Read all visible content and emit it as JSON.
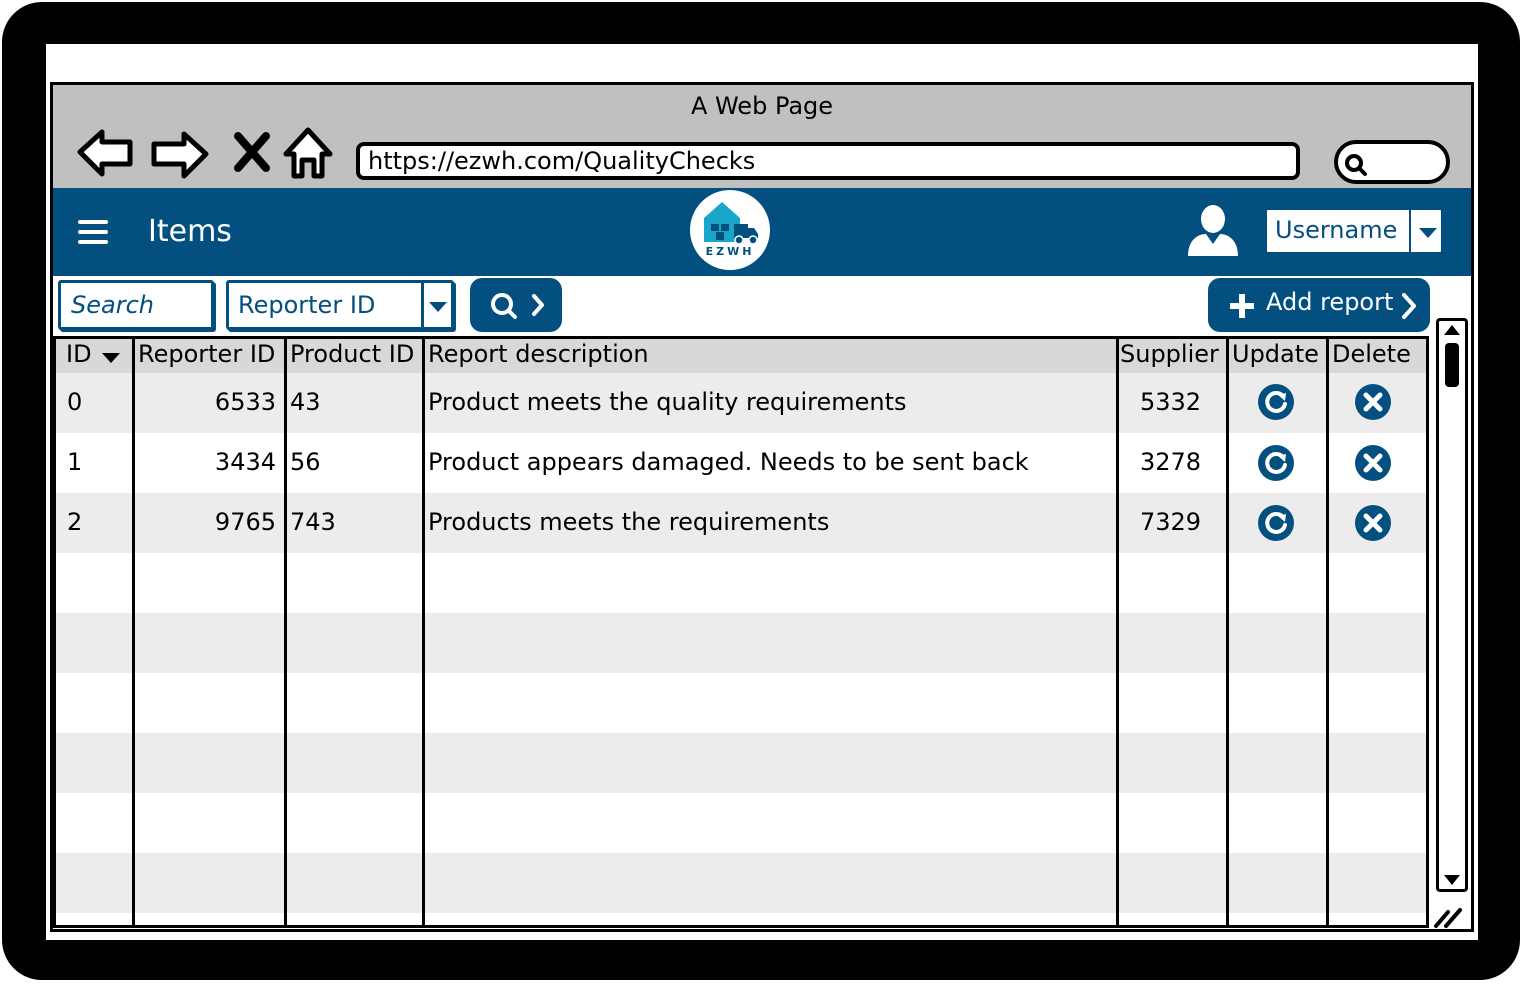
{
  "window": {
    "title": "A Web Page"
  },
  "browser": {
    "url": "https://ezwh.com/QualityChecks",
    "nav_icons": [
      "back-arrow-icon",
      "forward-arrow-icon",
      "close-x-icon",
      "home-icon"
    ],
    "search_icon": "search-icon"
  },
  "appbar": {
    "title": "Items",
    "logo_text": "EZWH",
    "username": "Username",
    "menu_icon": "hamburger-menu-icon",
    "user_icon": "user-avatar-icon"
  },
  "toolbar": {
    "search_placeholder": "Search",
    "filter_value": "Reporter ID",
    "search_button_icon": "search-icon",
    "add_label": "Add report"
  },
  "table": {
    "columns": [
      "ID",
      "Reporter ID",
      "Product ID",
      "Report description",
      "Supplier",
      "Update",
      "Delete"
    ],
    "sort_column": "ID",
    "rows": [
      {
        "id": "0",
        "reporter_id": "6533",
        "product_id": "43",
        "description": "Product meets the quality requirements",
        "supplier": "5332"
      },
      {
        "id": "1",
        "reporter_id": "3434",
        "product_id": "56",
        "description": "Product appears damaged. Needs to be sent back",
        "supplier": "3278"
      },
      {
        "id": "2",
        "reporter_id": "9765",
        "product_id": "743",
        "description": "Products meets the requirements",
        "supplier": "7329"
      }
    ],
    "row_icons": {
      "update": "refresh-icon",
      "delete": "delete-x-icon"
    }
  },
  "colors": {
    "brand": "#034f80",
    "header_bg": "#c0c0c0",
    "row_alt": "#ececec"
  }
}
